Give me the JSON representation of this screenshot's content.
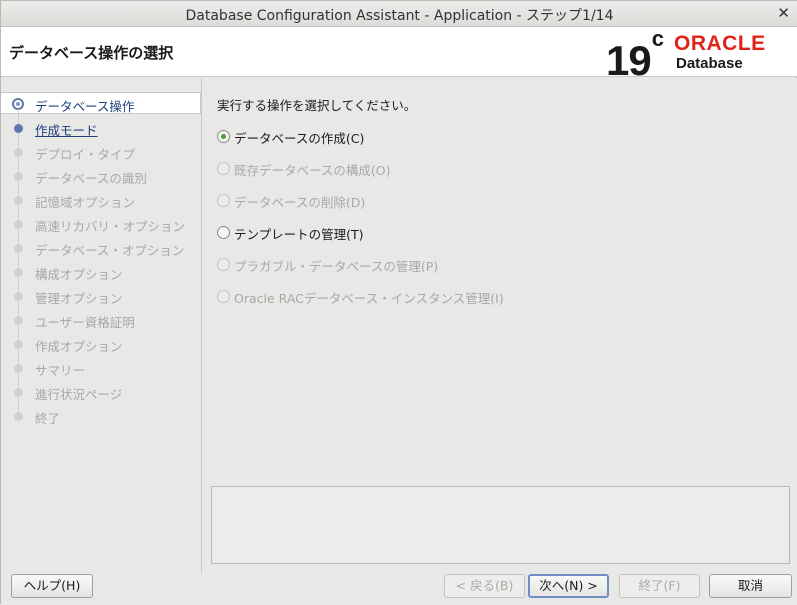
{
  "window": {
    "title": "Database Configuration Assistant - Application - ステップ1/14",
    "close_glyph": "✕"
  },
  "header": {
    "page_title": "データベース操作の選択",
    "brand": {
      "version": "19",
      "version_sup": "c",
      "oracle": "ORACLE",
      "product": "Database"
    }
  },
  "sidebar": {
    "steps": [
      {
        "label": "データベース操作",
        "state": "current"
      },
      {
        "label": "作成モード",
        "state": "next"
      },
      {
        "label": "デプロイ・タイプ",
        "state": "disabled"
      },
      {
        "label": "データベースの識別",
        "state": "disabled"
      },
      {
        "label": "記憶域オプション",
        "state": "disabled"
      },
      {
        "label": "高速リカバリ・オプション",
        "state": "disabled"
      },
      {
        "label": "データベース・オプション",
        "state": "disabled"
      },
      {
        "label": "構成オプション",
        "state": "disabled"
      },
      {
        "label": "管理オプション",
        "state": "disabled"
      },
      {
        "label": "ユーザー資格証明",
        "state": "disabled"
      },
      {
        "label": "作成オプション",
        "state": "disabled"
      },
      {
        "label": "サマリー",
        "state": "disabled"
      },
      {
        "label": "進行状況ページ",
        "state": "disabled"
      },
      {
        "label": "終了",
        "state": "disabled"
      }
    ]
  },
  "main": {
    "prompt": "実行する操作を選択してください。",
    "options": [
      {
        "label": "データベースの作成(C)",
        "checked": true,
        "enabled": true
      },
      {
        "label": "既存データベースの構成(O)",
        "checked": false,
        "enabled": false
      },
      {
        "label": "データベースの削除(D)",
        "checked": false,
        "enabled": false
      },
      {
        "label": "テンプレートの管理(T)",
        "checked": false,
        "enabled": true
      },
      {
        "label": "プラガブル・データベースの管理(P)",
        "checked": false,
        "enabled": false
      },
      {
        "label": "Oracle RACデータベース・インスタンス管理(I)",
        "checked": false,
        "enabled": false
      }
    ]
  },
  "footer": {
    "help": "ヘルプ(H)",
    "back": "< 戻る(B)",
    "next": "次へ(N) >",
    "finish": "終了(F)",
    "cancel": "取消"
  }
}
